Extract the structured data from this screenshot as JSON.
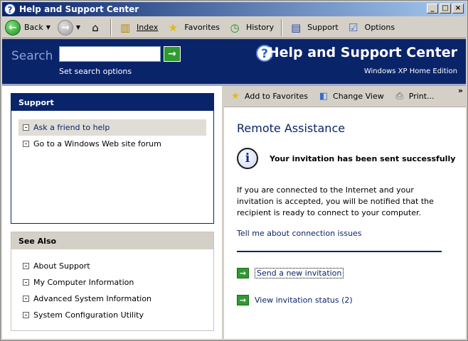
{
  "window": {
    "title": "Help and Support Center",
    "controls": {
      "minimize": "_",
      "maximize": "□",
      "close": "×"
    }
  },
  "toolbar": {
    "back": "Back",
    "index": "Index",
    "favorites": "Favorites",
    "history": "History",
    "support": "Support",
    "options": "Options"
  },
  "header": {
    "search_label": "Search",
    "search_value": "",
    "search_options": "Set search options",
    "title": "Help and Support Center",
    "edition": "Windows XP Home Edition"
  },
  "left": {
    "support": {
      "title": "Support",
      "items": [
        {
          "label": "Ask a friend to help",
          "selected": true
        },
        {
          "label": "Go to a Windows Web site forum",
          "selected": false
        }
      ]
    },
    "see_also": {
      "title": "See Also",
      "items": [
        {
          "label": "About Support"
        },
        {
          "label": "My Computer Information"
        },
        {
          "label": "Advanced System Information"
        },
        {
          "label": "System Configuration Utility"
        }
      ]
    }
  },
  "right": {
    "toolbar": {
      "add_favorites": "Add to Favorites",
      "change_view": "Change View",
      "print": "Print...",
      "more": "»"
    },
    "title": "Remote Assistance",
    "message": "Your invitation has been sent successfully",
    "paragraph": "If you are connected to the Internet and your invitation is accepted, you will be notified that the recipient is ready to connect to your computer.",
    "tell_link": "Tell me about connection issues",
    "actions": {
      "send_new": "Send a new invitation",
      "view_status": "View invitation status (2)"
    }
  },
  "colors": {
    "header_bg": "#0a246a",
    "accent_green": "#2f9a2f",
    "chrome": "#d4d0c8"
  }
}
